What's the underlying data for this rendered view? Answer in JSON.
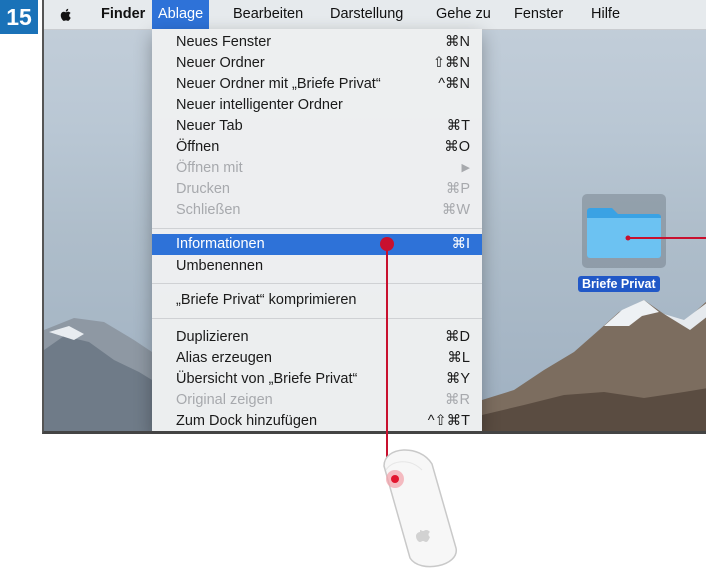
{
  "step_number": "15",
  "menubar": {
    "app_name": "Finder",
    "items": [
      "Ablage",
      "Bearbeiten",
      "Darstellung",
      "Gehe zu",
      "Fenster",
      "Hilfe"
    ]
  },
  "dropdown": {
    "rows": [
      {
        "label": "Neues Fenster",
        "shortcut": "⌘N"
      },
      {
        "label": "Neuer Ordner",
        "shortcut": "⇧⌘N"
      },
      {
        "label": "Neuer Ordner mit „Briefe Privat“",
        "shortcut": "^⌘N"
      },
      {
        "label": "Neuer intelligenter Ordner",
        "shortcut": ""
      },
      {
        "label": "Neuer Tab",
        "shortcut": "⌘T"
      },
      {
        "label": "Öffnen",
        "shortcut": "⌘O"
      },
      {
        "label": "Öffnen mit",
        "shortcut": "▶"
      },
      {
        "label": "Drucken",
        "shortcut": "⌘P"
      },
      {
        "label": "Schließen",
        "shortcut": "⌘W"
      },
      {
        "label": "Informationen",
        "shortcut": "⌘I"
      },
      {
        "label": "Umbenennen",
        "shortcut": ""
      },
      {
        "label": "„Briefe Privat“ komprimieren",
        "shortcut": ""
      },
      {
        "label": "Duplizieren",
        "shortcut": "⌘D"
      },
      {
        "label": "Alias erzeugen",
        "shortcut": "⌘L"
      },
      {
        "label": "Übersicht von „Briefe Privat“",
        "shortcut": "⌘Y"
      },
      {
        "label": "Original zeigen",
        "shortcut": "⌘R"
      },
      {
        "label": "Zum Dock hinzufügen",
        "shortcut": "^⇧⌘T"
      }
    ]
  },
  "desktop": {
    "folder_name": "Briefe Privat"
  },
  "icons": {
    "apple": "apple-logo-icon",
    "folder": "folder-icon",
    "mouse": "magic-mouse-icon"
  },
  "colors": {
    "step_badge": "#1a72b8",
    "menu_highlight": "#2e72d8",
    "folder_label": "#2158c7",
    "pointer_line": "#c8102e"
  }
}
